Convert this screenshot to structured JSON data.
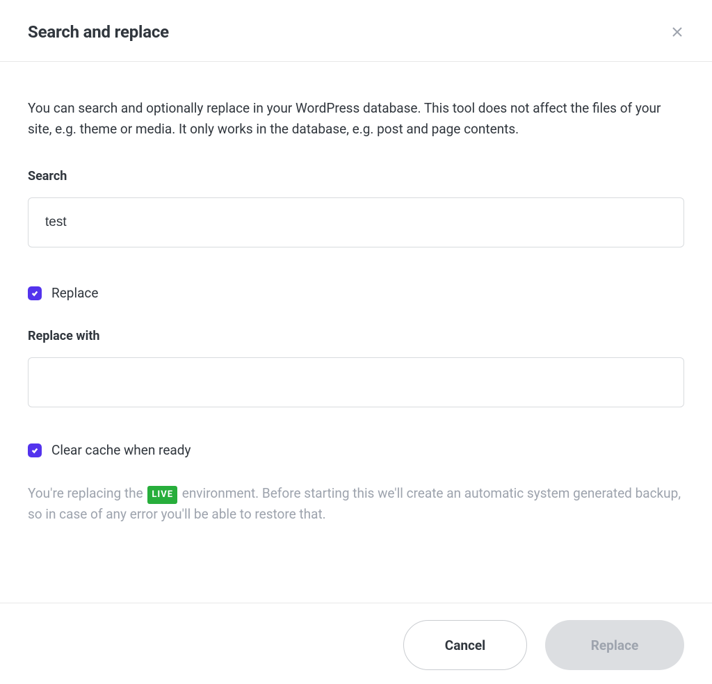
{
  "header": {
    "title": "Search and replace"
  },
  "main": {
    "description": "You can search and optionally replace in your WordPress database. This tool does not affect the files of your site, e.g. theme or media. It only works in the database, e.g. post and page contents.",
    "search_label": "Search",
    "search_value": "test",
    "replace_checkbox_label": "Replace",
    "replace_with_label": "Replace with",
    "replace_with_value": "",
    "clear_cache_label": "Clear cache when ready",
    "note_prefix": "You're replacing the ",
    "live_badge": "LIVE",
    "note_suffix": " environment. Before starting this we'll create an automatic system generated backup, so in case of any error you'll be able to restore that."
  },
  "footer": {
    "cancel_label": "Cancel",
    "replace_label": "Replace"
  }
}
